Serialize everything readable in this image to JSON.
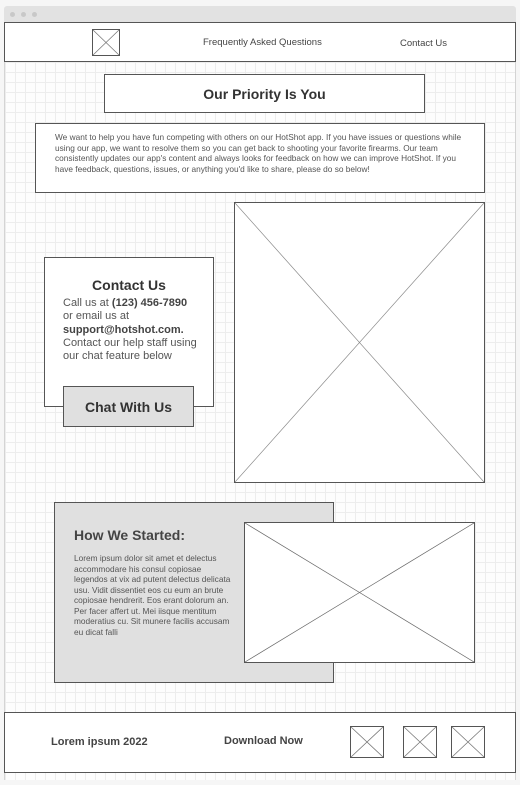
{
  "nav": {
    "faq_link": "Frequently Asked Questions",
    "contact_link": "Contact Us",
    "logo_icon": "image-placeholder-icon"
  },
  "hero": {
    "title": "Our Priority Is You",
    "intro": "We want to help you have fun competing with others on our HotShot app. If you have issues or questions while using our app, we want to resolve them so you can get back to shooting your favorite firearms. Our team consistently updates our app's content and always looks for feedback on how we can improve HotShot. If you have feedback, questions, issues, or anything you'd like to share, please do so below!"
  },
  "contact": {
    "heading": "Contact Us",
    "call_prefix": "Call us at ",
    "phone": "(123) 456-7890",
    "email_prefix": "or email us at",
    "email": "support@hotshot.com.",
    "chat_note": "Contact our help staff using our chat feature below",
    "chat_button": "Chat With Us"
  },
  "story": {
    "heading": "How We Started:",
    "body": "Lorem ipsum dolor sit amet et delectus accommodare his consul copiosae legendos at vix ad putent delectus delicata usu. Vidit dissentiet eos cu eum an brute copiosae hendrerit. Eos erant dolorum an. Per facer affert ut. Mei iisque mentitum moderatius cu. Sit munere facilis accusam eu dicat falli"
  },
  "footer": {
    "copyright": "Lorem ipsum 2022",
    "download": "Download Now",
    "icons": [
      "image-placeholder-icon",
      "image-placeholder-icon",
      "image-placeholder-icon"
    ]
  },
  "colors": {
    "border": "#555555",
    "panel_fill": "#e0e0e0",
    "grid": "#ededed"
  }
}
